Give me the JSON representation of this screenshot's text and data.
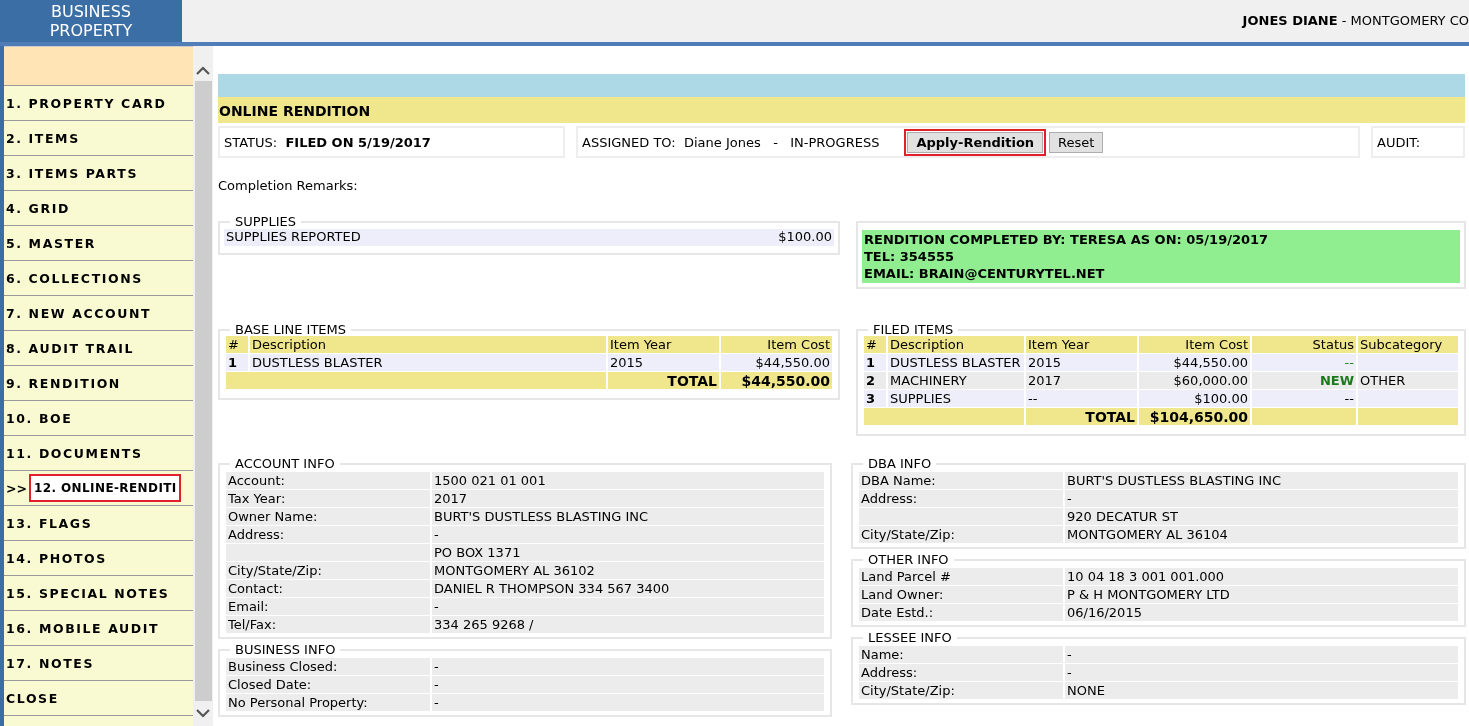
{
  "header": {
    "logo": "BUSINESS PROPERTY",
    "user": "**JONES DIANE** - MONTGOMERY CO"
  },
  "sidebar": {
    "items": [
      {
        "label": "1. PROPERTY CARD",
        "selected": false
      },
      {
        "label": "2. ITEMS",
        "selected": false
      },
      {
        "label": "3. ITEMS PARTS",
        "selected": false
      },
      {
        "label": "4. GRID",
        "selected": false
      },
      {
        "label": "5. MASTER",
        "selected": false
      },
      {
        "label": "6. COLLECTIONS",
        "selected": false
      },
      {
        "label": "7. NEW ACCOUNT",
        "selected": false
      },
      {
        "label": "8. AUDIT TRAIL",
        "selected": false
      },
      {
        "label": "9. RENDITION",
        "selected": false
      },
      {
        "label": "10. BOE",
        "selected": false
      },
      {
        "label": "11. DOCUMENTS",
        "selected": false
      },
      {
        "label": "12. ONLINE-RENDITI",
        "selected": true,
        "prefix": ">>"
      },
      {
        "label": "13. FLAGS",
        "selected": false
      },
      {
        "label": "14. PHOTOS",
        "selected": false
      },
      {
        "label": "15. SPECIAL NOTES",
        "selected": false
      },
      {
        "label": "16. MOBILE AUDIT",
        "selected": false
      },
      {
        "label": "17. NOTES",
        "selected": false
      },
      {
        "label": "CLOSE",
        "selected": false
      }
    ]
  },
  "section_title": "ONLINE RENDITION",
  "status": {
    "label": "STATUS:",
    "value": "FILED ON 5/19/2017"
  },
  "assignment": "ASSIGNED TO:  Diane Jones   -   IN-PROGRESS",
  "buttons": [
    {
      "label": "Apply-Rendition",
      "kind": "primary",
      "highlighted": true
    },
    {
      "label": "Reset",
      "kind": "plain",
      "highlighted": false
    }
  ],
  "audit": {
    "label": "AUDIT:"
  },
  "completion_remarks": "Completion Remarks:",
  "supplies": {
    "title": "SUPPLIES",
    "label": "SUPPLIES REPORTED",
    "value": "$100.00"
  },
  "completion_note": {
    "lines": [
      "RENDITION COMPLETED BY: TERESA AS ON: 05/19/2017",
      "TEL: 354555",
      "EMAIL: BRAIN@CENTURYTEL.NET"
    ]
  },
  "baseline": {
    "title": "BASE LINE ITEMS",
    "columns": [
      "#",
      "Description",
      "Item Year",
      "Item Cost"
    ],
    "rows": [
      {
        "num": "1",
        "description": "DUSTLESS BLASTER",
        "year": "2015",
        "cost": "$44,550.00"
      }
    ],
    "total": {
      "label": "TOTAL",
      "value": "$44,550.00"
    }
  },
  "filed": {
    "title": "FILED ITEMS",
    "columns": [
      "#",
      "Description",
      "Item Year",
      "Item Cost",
      "Status",
      "Subcategory"
    ],
    "rows": [
      {
        "num": "1",
        "description": "DUSTLESS BLASTER",
        "year": "2015",
        "cost": "$44,550.00",
        "status": "--",
        "color": "#1a8a1a",
        "new": false
      },
      {
        "num": "2",
        "description": "MACHINERY",
        "year": "2017",
        "cost": "$60,000.00",
        "status": "NEW",
        "color": "#1a7a1a",
        "new": true,
        "subcategory": "OTHER"
      },
      {
        "num": "3",
        "description": "SUPPLIES",
        "year": "--",
        "cost": "$100.00",
        "status": "--",
        "color": "#000000",
        "new": false
      }
    ],
    "total": {
      "label": "TOTAL",
      "value": "$104,650.00"
    }
  },
  "account_info": {
    "title": "ACCOUNT INFO",
    "rows": [
      {
        "label": "Account:",
        "value": "1500 021 01 001"
      },
      {
        "label": "Tax Year:",
        "value": "2017"
      },
      {
        "label": "Owner Name:",
        "value": "BURT'S DUSTLESS BLASTING INC"
      },
      {
        "label": "Address:",
        "value": "-"
      },
      {
        "value": "PO BOX 1371"
      },
      {
        "label": "City/State/Zip:",
        "value": "MONTGOMERY AL 36102"
      },
      {
        "label": "Contact:",
        "value": "DANIEL R THOMPSON 334 567 3400"
      },
      {
        "label": "Email:",
        "value": "-"
      },
      {
        "label": "Tel/Fax:",
        "value": "334 265 9268 /"
      }
    ]
  },
  "business_info": {
    "title": "BUSINESS INFO",
    "rows": [
      {
        "label": "Business Closed:",
        "value": "-"
      },
      {
        "label": "Closed Date:",
        "value": "-"
      },
      {
        "label": "No Personal Property:",
        "value": "-"
      }
    ]
  },
  "dba_info": {
    "title": "DBA INFO",
    "rows": [
      {
        "label": "DBA Name:",
        "value": "BURT'S DUSTLESS BLASTING INC"
      },
      {
        "label": "Address:",
        "value": "-"
      },
      {
        "value": "920 DECATUR ST"
      },
      {
        "label": "City/State/Zip:",
        "value": "MONTGOMERY AL 36104"
      }
    ]
  },
  "other_info": {
    "title": "OTHER INFO",
    "rows": [
      {
        "label": "Land Parcel #",
        "value": "10 04 18 3 001 001.000"
      },
      {
        "label": "Land Owner:",
        "value": "P & H MONTGOMERY LTD"
      },
      {
        "label": "Date Estd.:",
        "value": "06/16/2015"
      }
    ]
  },
  "lessee_info": {
    "title": "LESSEE INFO",
    "rows": [
      {
        "label": "Name:",
        "value": "-"
      },
      {
        "label": "Address:",
        "value": "-"
      },
      {
        "label": "City/State/Zip:",
        "value": "NONE"
      }
    ]
  }
}
